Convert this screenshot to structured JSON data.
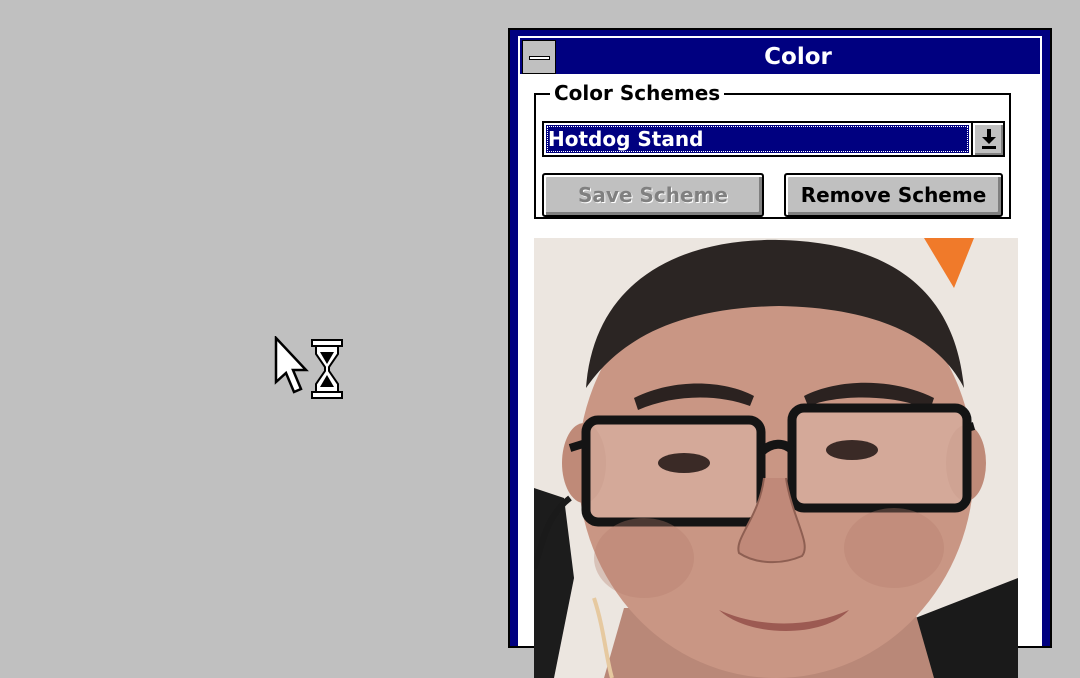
{
  "window": {
    "title": "Color"
  },
  "color_schemes": {
    "group_label": "Color Schemes",
    "selected_scheme": "Hotdog Stand",
    "dropdown_icon": "down-arrow-icon"
  },
  "buttons": {
    "save_scheme": "Save Scheme",
    "remove_scheme": "Remove Scheme"
  },
  "cursor": {
    "icon": "arrow-hourglass-busy-cursor"
  },
  "photo": {
    "icon": "face-photo"
  },
  "colors": {
    "desktop": "#c0c0c0",
    "title_bar": "#000080",
    "selection": "#000080",
    "button_face": "#c0c0c0"
  }
}
